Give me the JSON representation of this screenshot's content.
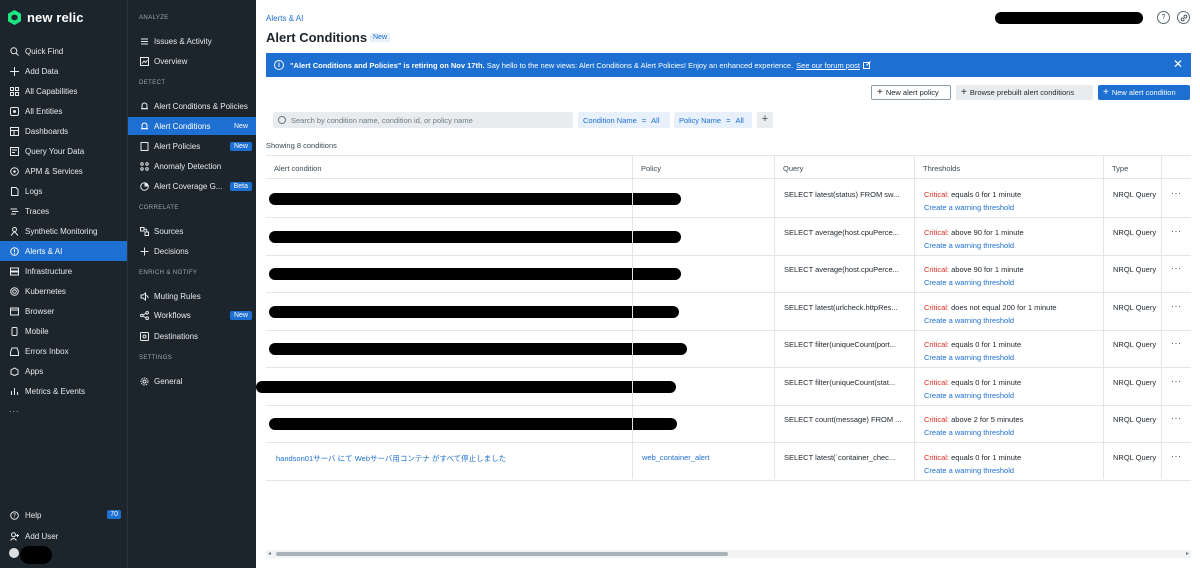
{
  "brand": {
    "name": "new relic"
  },
  "nav": {
    "items": [
      {
        "label": "Quick Find",
        "icon": "search-icon"
      },
      {
        "label": "Add Data",
        "icon": "plus-icon"
      },
      {
        "label": "All Capabilities",
        "icon": "grid-icon"
      },
      {
        "label": "All Entities",
        "icon": "entities-icon"
      },
      {
        "label": "Dashboards",
        "icon": "dashboard-icon"
      },
      {
        "label": "Query Your Data",
        "icon": "query-icon"
      },
      {
        "label": "APM & Services",
        "icon": "apm-icon"
      },
      {
        "label": "Logs",
        "icon": "logs-icon"
      },
      {
        "label": "Traces",
        "icon": "traces-icon"
      },
      {
        "label": "Synthetic Monitoring",
        "icon": "synthetics-icon"
      },
      {
        "label": "Alerts & AI",
        "icon": "alert-icon",
        "active": true
      },
      {
        "label": "Infrastructure",
        "icon": "infrastructure-icon"
      },
      {
        "label": "Kubernetes",
        "icon": "kubernetes-icon"
      },
      {
        "label": "Browser",
        "icon": "browser-icon"
      },
      {
        "label": "Mobile",
        "icon": "mobile-icon"
      },
      {
        "label": "Errors Inbox",
        "icon": "inbox-icon"
      },
      {
        "label": "Apps",
        "icon": "apps-icon"
      },
      {
        "label": "Metrics & Events",
        "icon": "metrics-icon"
      }
    ],
    "more": "...",
    "help": {
      "label": "Help",
      "badge": "70"
    },
    "add_user": "Add User"
  },
  "subnav": {
    "sections": {
      "analyze": "ANALYZE",
      "detect": "DETECT",
      "correlate": "CORRELATE",
      "enrich": "ENRICH & NOTIFY",
      "settings": "SETTINGS"
    },
    "issues": "Issues & Activity",
    "overview": "Overview",
    "conditions_policies": "Alert Conditions & Policies",
    "alert_conditions": "Alert Conditions",
    "alert_conditions_badge": "New",
    "alert_policies": "Alert Policies",
    "alert_policies_badge": "New",
    "anomaly": "Anomaly Detection",
    "coverage": "Alert Coverage G...",
    "coverage_badge": "Beta",
    "sources": "Sources",
    "decisions": "Decisions",
    "muting": "Muting Rules",
    "workflows": "Workflows",
    "workflows_badge": "New",
    "destinations": "Destinations",
    "general": "General"
  },
  "header": {
    "breadcrumb": "Alerts & AI",
    "title": "Alert Conditions",
    "title_badge": "New"
  },
  "banner": {
    "bold": "\"Alert Conditions and Policies\" is retiring on Nov 17th.",
    "text": "Say hello to the new views: Alert Conditions & Alert Policies! Enjoy an enhanced experience.",
    "link": "See our forum post"
  },
  "toolbar": {
    "new_policy": "New alert policy",
    "prebuilt": "Browse prebuilt alert conditions",
    "new_condition": "New alert condition"
  },
  "filters": {
    "search_placeholder": "Search by condition name, condition id, or policy name",
    "name": {
      "field": "Condition Name",
      "op": "=",
      "value": "All"
    },
    "policy": {
      "field": "Policy Name",
      "op": "=",
      "value": "All"
    }
  },
  "showing": "Showing 8 conditions",
  "table": {
    "columns": [
      "Alert condition",
      "Policy",
      "Query",
      "Thresholds",
      "Type"
    ],
    "warning_link": "Create a warning threshold",
    "critical_label": "Critical:",
    "rows": [
      {
        "name": "",
        "policy": "",
        "query": "SELECT latest(status) FROM sw...",
        "threshold": "equals 0 for 1 minute",
        "type": "NRQL Query"
      },
      {
        "name": "",
        "policy": "",
        "query": "SELECT average(host.cpuPerce...",
        "threshold": "above 90 for 1 minute",
        "type": "NRQL Query"
      },
      {
        "name": "",
        "policy": "",
        "query": "SELECT average(host.cpuPerce...",
        "threshold": "above 90 for 1 minute",
        "type": "NRQL Query"
      },
      {
        "name": "",
        "policy": "",
        "query": "SELECT latest(urlcheck.httpRes...",
        "threshold": "does not equal 200 for 1 minute",
        "type": "NRQL Query"
      },
      {
        "name": "",
        "policy": "",
        "query": "SELECT filter(uniqueCount(port...",
        "threshold": "equals 0 for 1 minute",
        "type": "NRQL Query"
      },
      {
        "name": "",
        "policy": "",
        "query": "SELECT filter(uniqueCount(stat...",
        "threshold": "equals 0 for 1 minute",
        "type": "NRQL Query"
      },
      {
        "name": "",
        "policy": "",
        "query": "SELECT count(message) FROM ...",
        "threshold": "above 2 for 5 minutes",
        "type": "NRQL Query"
      },
      {
        "name": "handson01サーバ にて Webサーバ用コンテナ がすべて停止しました",
        "policy": "web_container_alert",
        "query": "SELECT latest(`container_chec...",
        "threshold": "equals 0 for 1 minute",
        "type": "NRQL Query"
      }
    ]
  },
  "colors": {
    "accent": "#1d6fd1",
    "nav_bg": "#1d252c",
    "critical": "#df2d24"
  }
}
